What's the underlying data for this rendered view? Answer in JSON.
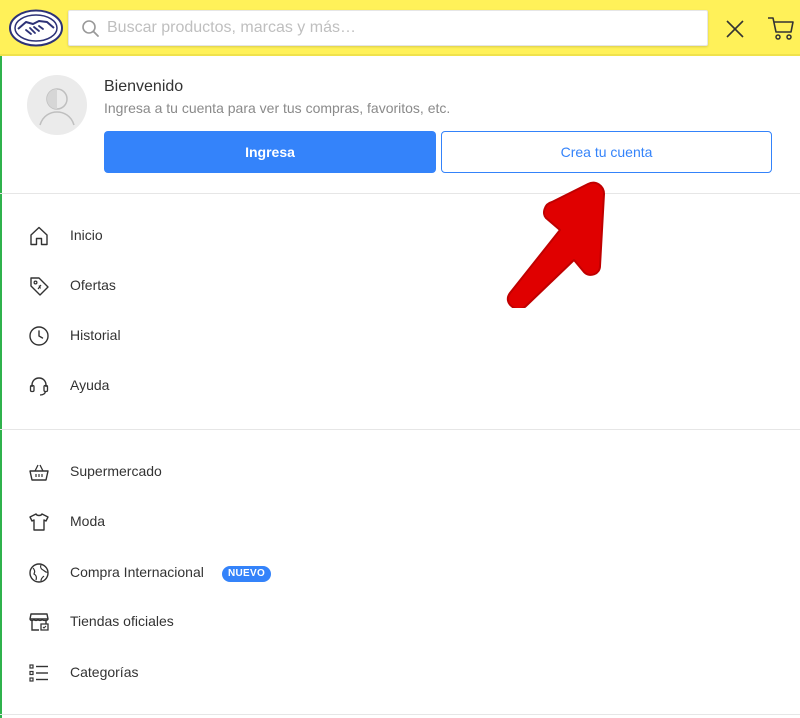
{
  "header": {
    "search_placeholder": "Buscar productos, marcas y más…",
    "icons": {
      "logo": "handshake-logo",
      "search": "search-icon",
      "close": "close-icon",
      "cart": "cart-icon"
    }
  },
  "profile": {
    "title": "Bienvenido",
    "subtitle": "Ingresa a tu cuenta para ver tus compras, favoritos, etc.",
    "login_button": "Ingresa",
    "create_button": "Crea tu cuenta"
  },
  "menu_primary": [
    {
      "label": "Inicio",
      "icon": "home-icon"
    },
    {
      "label": "Ofertas",
      "icon": "tag-icon"
    },
    {
      "label": "Historial",
      "icon": "clock-icon"
    },
    {
      "label": "Ayuda",
      "icon": "headset-icon"
    }
  ],
  "menu_secondary": [
    {
      "label": "Supermercado",
      "icon": "basket-icon"
    },
    {
      "label": "Moda",
      "icon": "shirt-icon"
    },
    {
      "label": "Compra Internacional",
      "icon": "globe-icon",
      "badge": "NUEVO"
    },
    {
      "label": "Tiendas oficiales",
      "icon": "store-icon"
    },
    {
      "label": "Categorías",
      "icon": "list-icon"
    }
  ],
  "colors": {
    "header_bg": "#fff159",
    "primary": "#3483fa",
    "annotation_arrow": "#e00000"
  }
}
